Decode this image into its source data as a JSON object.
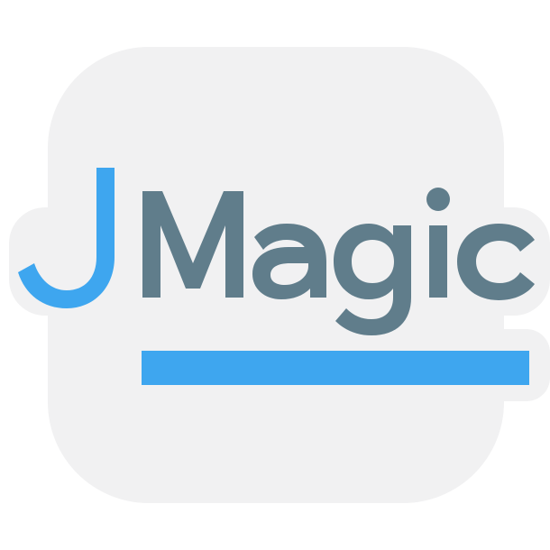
{
  "logo": {
    "wordmark_initial": "J",
    "wordmark_rest": "Magic",
    "colors": {
      "tile": "#f1f1f2",
      "initial": "#3ea6ef",
      "wordmark": "#607d8b",
      "underline": "#3ea6ef",
      "outline": "#ffffff"
    }
  }
}
